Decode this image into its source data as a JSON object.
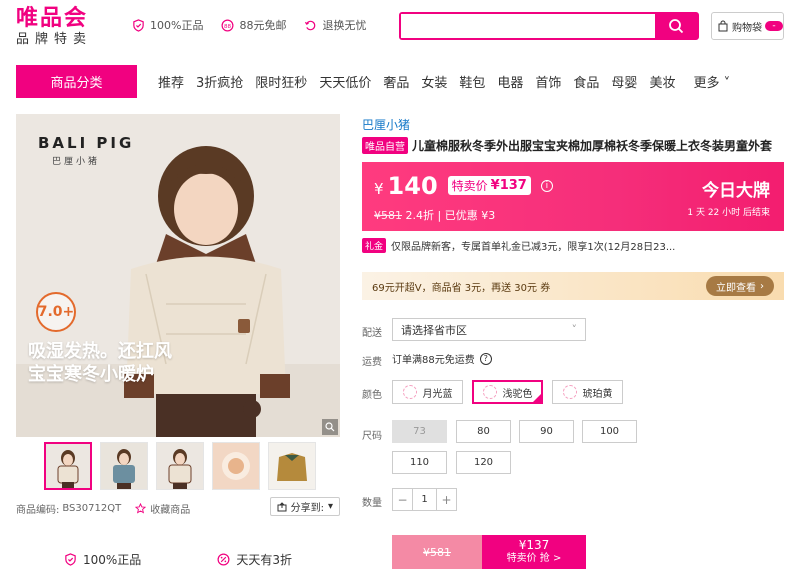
{
  "header": {
    "logo_main": "唯品会",
    "logo_sub": "品牌特卖",
    "promises": [
      "100%正品",
      "88元免邮",
      "退换无忧"
    ],
    "search_placeholder": "",
    "cart_label": "购物袋",
    "cart_count": "-"
  },
  "nav": {
    "category": "商品分类",
    "items": [
      "推荐",
      "3折疯抢",
      "限时狂秒",
      "天天低价",
      "奢品",
      "女装",
      "鞋包",
      "电器",
      "首饰",
      "食品",
      "母婴",
      "美妆"
    ],
    "more": "更多"
  },
  "gallery": {
    "brand_logo": "BALI PIG",
    "brand_logo_sub": "巴厘小猪",
    "temp_badge": "7.0+",
    "promo_line1": "吸湿发热。还扛风",
    "promo_line2": "宝宝寒冬小暖炉",
    "thumb_count": 5,
    "code_label": "商品编码:",
    "code_value": "BS30712QT",
    "fav_label": "收藏商品",
    "share_label": "分享到:"
  },
  "bottom_promises": [
    "100%正品",
    "天天有3折"
  ],
  "product": {
    "brand": "巴厘小猪",
    "self_tag": "唯品自营",
    "title": "儿童棉服秋冬季外出服宝宝夹棉加厚棉袄冬季保暖上衣冬装男童外套",
    "price_yen": "¥",
    "price": "140",
    "sale_tag_label": "特卖价",
    "sale_price": "¥137",
    "orig_price": "¥581",
    "discount": "2.4折",
    "saved": "已优惠 ¥3",
    "today_label": "今日大牌",
    "countdown": "1 天 22 小时 后结束",
    "coupon_tag": "礼金",
    "coupon_text": "仅限品牌新客，专属首单礼金已减3元，限享1次(12月28日23...",
    "vip_text": "69元开超V，商品省 3元，再送 30元 券",
    "vip_btn": "立即查看"
  },
  "options": {
    "ship_label": "配送",
    "ship_select": "请选择省市区",
    "fee_label": "运费",
    "fee_text": "订单满88元免运费",
    "color_label": "颜色",
    "colors": [
      "月光蓝",
      "浅驼色",
      "琥珀黄"
    ],
    "size_label": "尺码",
    "sizes": [
      "73",
      "80",
      "90",
      "100",
      "110",
      "120"
    ],
    "qty_label": "数量",
    "qty_minus": "−",
    "qty_value": "1",
    "qty_plus": "+"
  },
  "buy": {
    "orig": "¥581",
    "sale_price": "¥137",
    "sale_label": "特卖价 抢 >"
  },
  "colors": {
    "brand": "#f10180",
    "vip": "#a77a44"
  }
}
